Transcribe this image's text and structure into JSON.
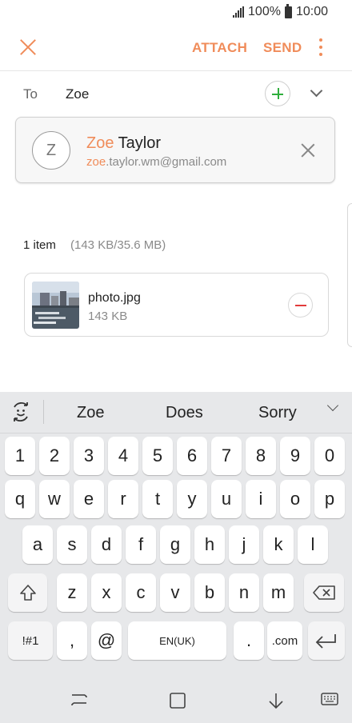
{
  "status_bar": {
    "battery": "100%",
    "time": "10:00"
  },
  "toolbar": {
    "attach_label": "ATTACH",
    "send_label": "SEND",
    "accent_color": "#f08c5a"
  },
  "recipient": {
    "to_label": "To",
    "to_value": "Zoe"
  },
  "suggestion": {
    "avatar_initial": "Z",
    "name_match": "Zoe",
    "name_rest": " Taylor",
    "email_match": "zoe",
    "email_rest": ".taylor.wm@gmail.com"
  },
  "attachments": {
    "count_label": "1 item",
    "size_label": "(143 KB/35.6 MB)",
    "items": [
      {
        "name": "photo.jpg",
        "size": "143 KB"
      }
    ]
  },
  "keyboard": {
    "suggestions": [
      "Zoe",
      "Does",
      "Sorry"
    ],
    "rows": [
      [
        "1",
        "2",
        "3",
        "4",
        "5",
        "6",
        "7",
        "8",
        "9",
        "0"
      ],
      [
        "q",
        "w",
        "e",
        "r",
        "t",
        "y",
        "u",
        "i",
        "o",
        "p"
      ],
      [
        "a",
        "s",
        "d",
        "f",
        "g",
        "h",
        "j",
        "k",
        "l"
      ],
      [
        "z",
        "x",
        "c",
        "v",
        "b",
        "n",
        "m"
      ]
    ],
    "symbols_label": "!#1",
    "comma_label": ",",
    "at_label": "@",
    "space_label": "EN(UK)",
    "period_label": ".",
    "dotcom_label": ".com"
  }
}
